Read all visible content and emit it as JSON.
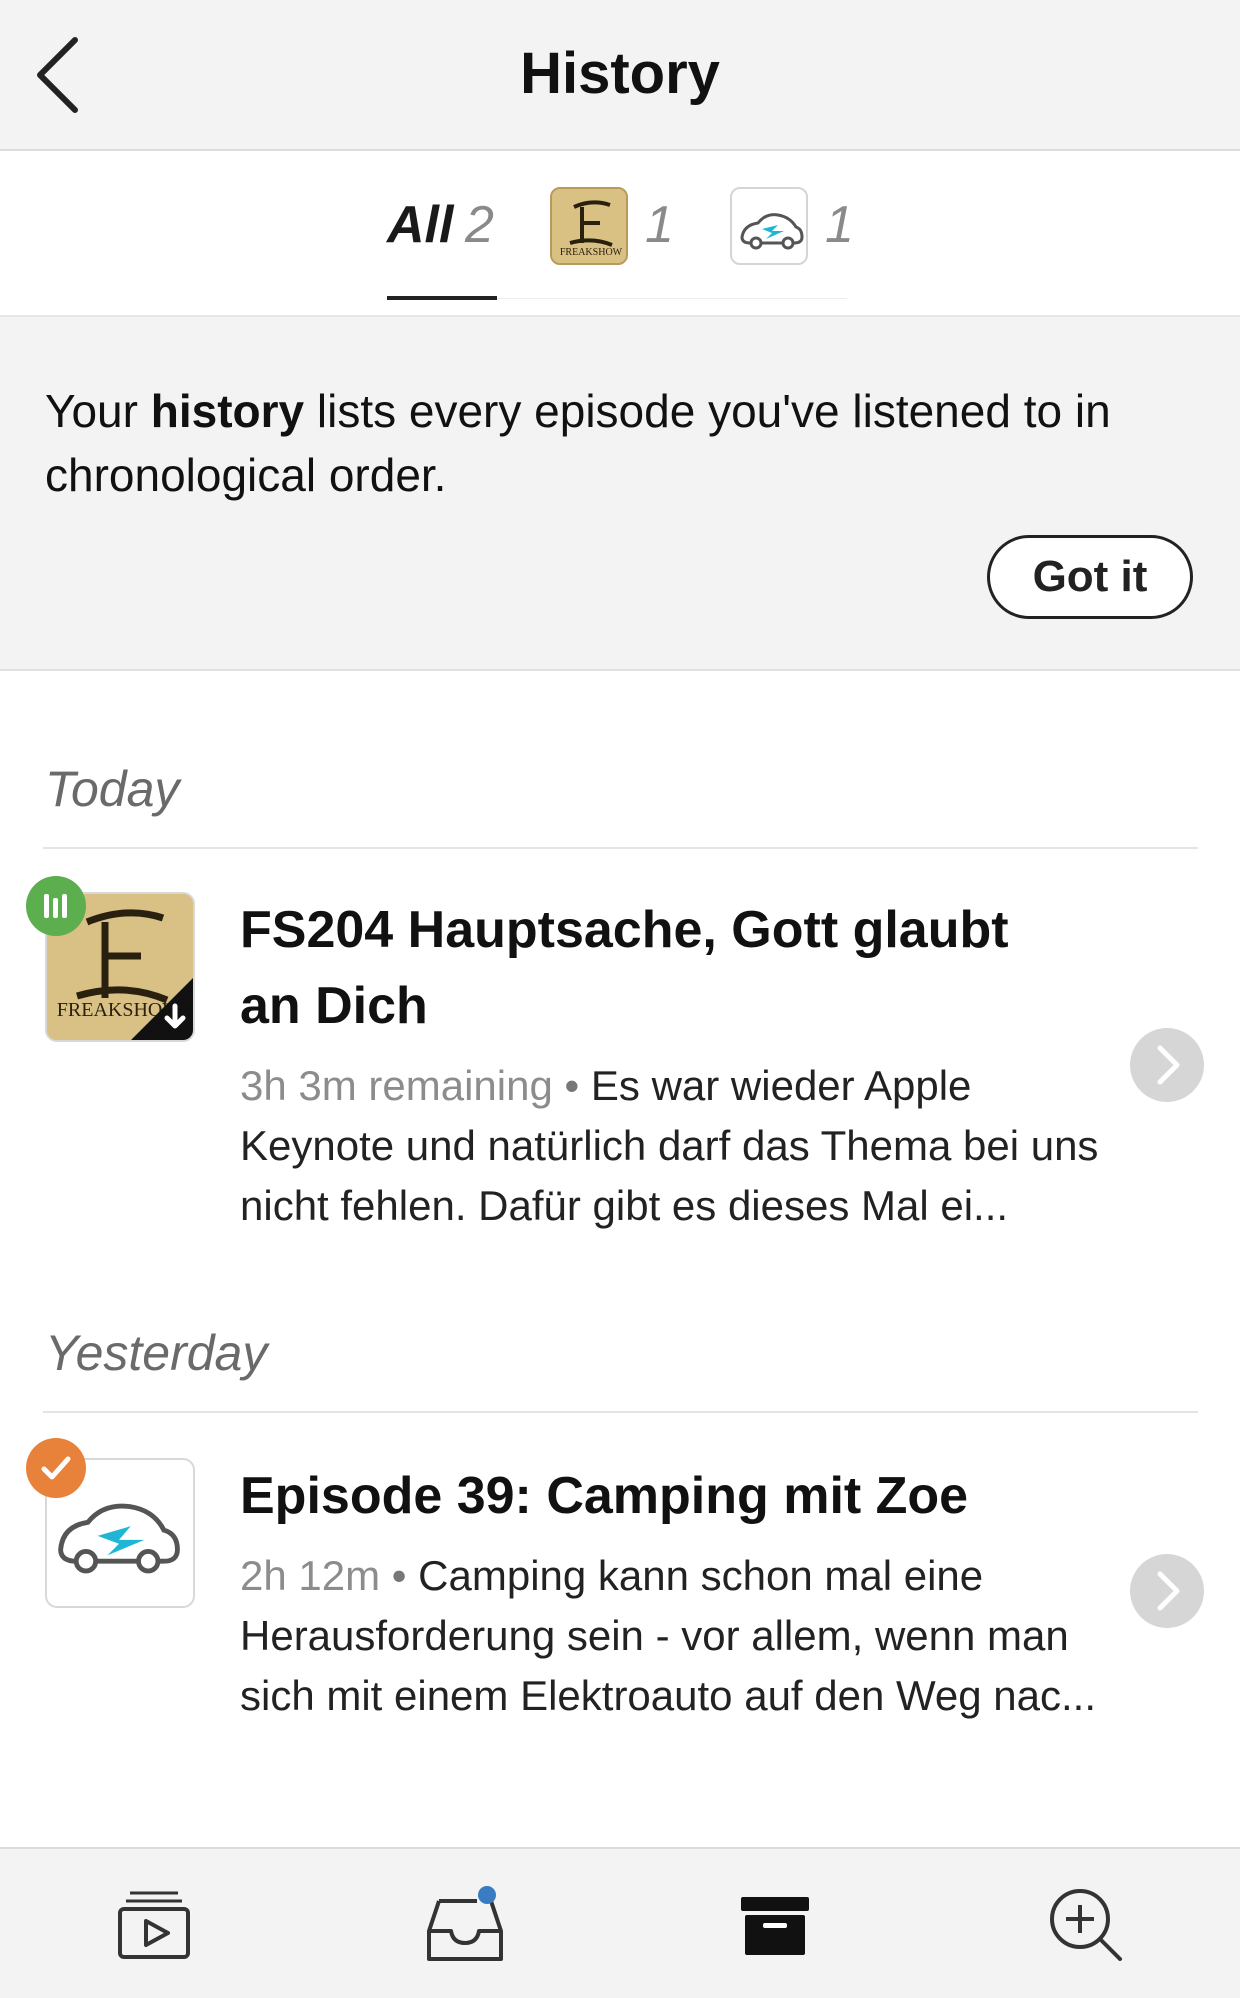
{
  "header": {
    "title": "History"
  },
  "filters": [
    {
      "label": "All",
      "count": "2"
    },
    {
      "label": "",
      "count": "1",
      "podcast_art": "Freak Show logo"
    },
    {
      "label": "",
      "count": "1",
      "podcast_art": "electric car logo"
    }
  ],
  "info_banner": {
    "text_before": "Your ",
    "text_bold": "history",
    "text_after": " lists every episode you've listened to in chronological order.",
    "button_label": "Got it"
  },
  "sections": [
    {
      "heading": "Today",
      "episode": {
        "title": "FS204 Hauptsache, Gott glaubt an Dich",
        "meta": "3h 3m remaining",
        "description": "Es war wieder Apple Keynote und natürlich darf das Thema bei uns nicht fehlen. Dafür gibt es dieses Mal ei...",
        "artwork_text": "FREAKSHOW",
        "status": "playing",
        "status_color": "#5cae4f"
      }
    },
    {
      "heading": "Yesterday",
      "episode": {
        "title": "Episode 39: Camping mit Zoe",
        "meta": "2h 12m",
        "description": "Camping kann schon mal eine Herausforderung sein - vor allem, wenn man sich mit einem Elektroauto auf den Weg nac...",
        "status": "played",
        "status_color": "#e8823a"
      }
    }
  ],
  "bottom_nav": [
    {
      "icon": "play-queue-icon"
    },
    {
      "icon": "inbox-icon",
      "has_notification_dot": true
    },
    {
      "icon": "archive-icon",
      "active": true
    },
    {
      "icon": "search-add-icon"
    }
  ],
  "colors": {
    "accent_dot": "#3a7cc1",
    "bg_gray": "#f3f3f3"
  }
}
